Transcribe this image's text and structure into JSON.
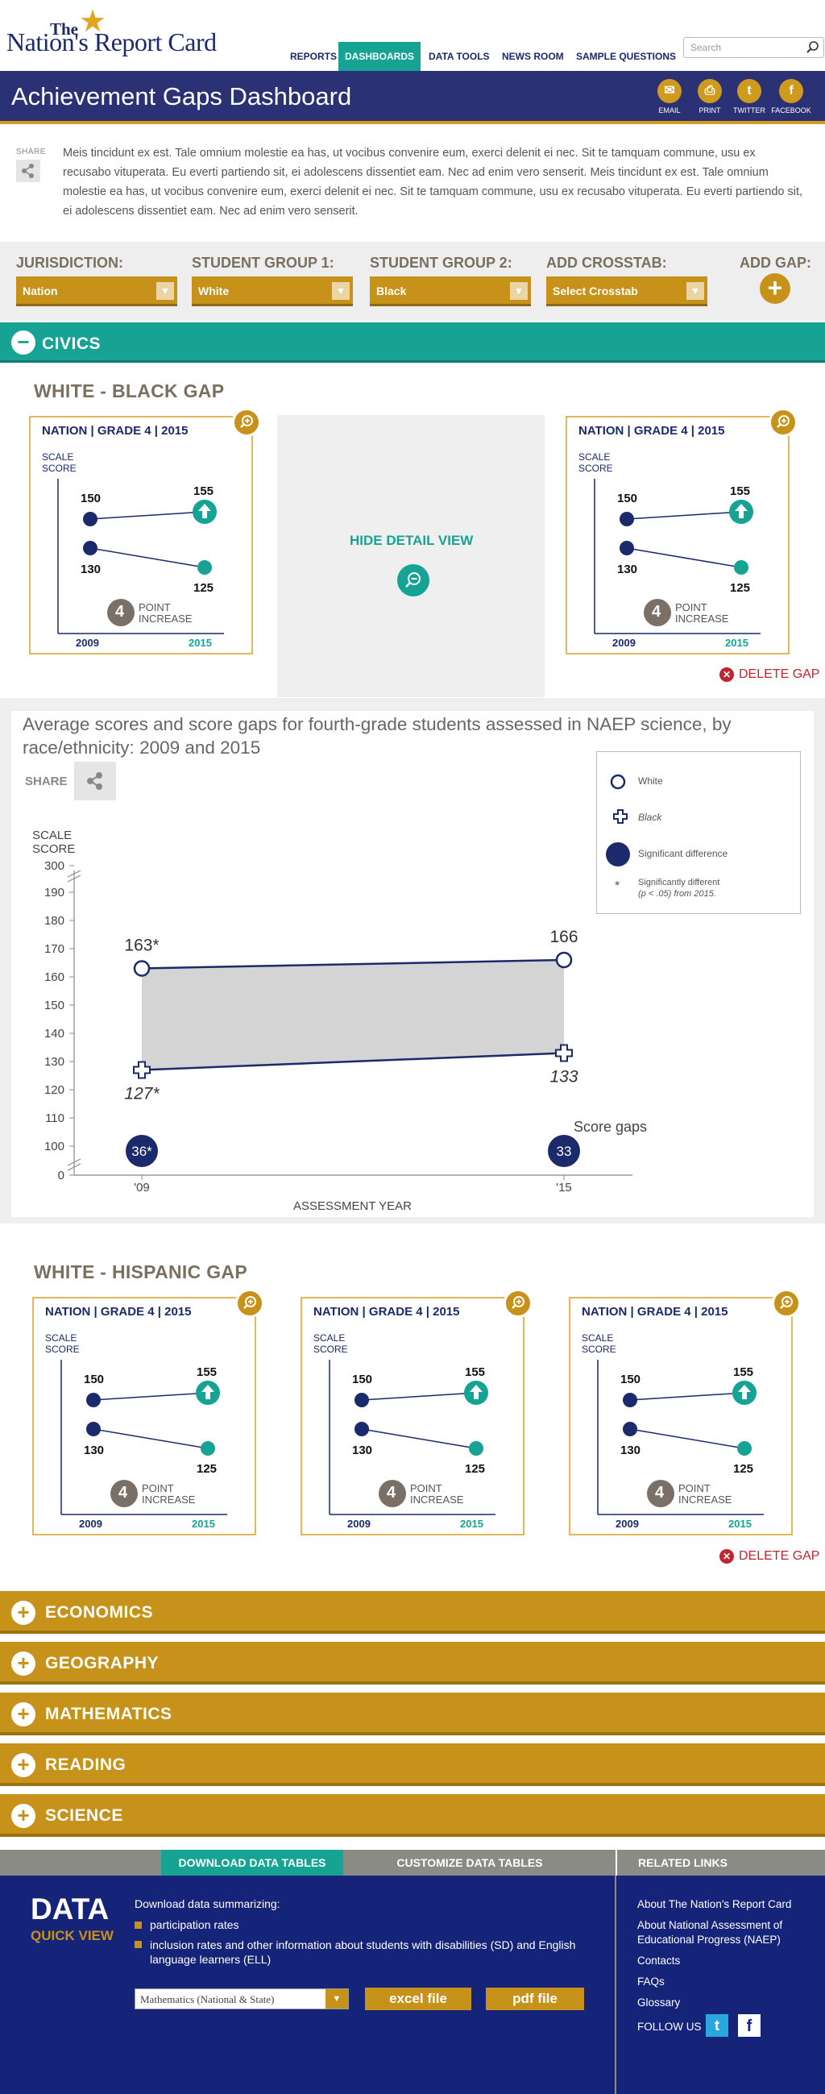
{
  "header": {
    "logo_the": "The",
    "logo_main": "Nation's Report Card",
    "nav": [
      "REPORTS",
      "DASHBOARDS",
      "DATA TOOLS",
      "NEWS ROOM",
      "SAMPLE QUESTIONS"
    ],
    "search_placeholder": "Search",
    "title": "Achievement Gaps Dashboard",
    "social": [
      {
        "label": "EMAIL",
        "glyph": "✉"
      },
      {
        "label": "PRINT",
        "glyph": "⎙"
      },
      {
        "label": "TWITTER",
        "glyph": "t"
      },
      {
        "label": "FACEBOOK",
        "glyph": "f"
      }
    ]
  },
  "intro": {
    "share_label": "SHARE",
    "text": "Meis tincidunt ex est. Tale omnium molestie ea has, ut vocibus convenire eum, exerci delenit ei nec. Sit te tamquam commune, usu ex recusabo vituperata. Eu everti partiendo sit, ei adolescens dissentiet eam. Nec ad enim vero senserit. Meis tincidunt ex est. Tale omnium molestie ea has, ut vocibus convenire eum, exerci delenit ei nec. Sit te tamquam commune, usu ex recusabo vituperata. Eu everti partiendo sit, ei adolescens dissentiet eam. Nec ad enim vero senserit."
  },
  "filters": {
    "jurisdiction_label": "JURISDICTION:",
    "jurisdiction_value": "Nation",
    "group1_label": "STUDENT GROUP 1:",
    "group1_value": "White",
    "group2_label": "STUDENT GROUP 2:",
    "group2_value": "Black",
    "crosstab_label": "ADD CROSSTAB:",
    "crosstab_value": "Select Crosstab",
    "addgap_label": "ADD GAP:"
  },
  "civics": {
    "title": "CIVICS",
    "gap1_title": "WHITE - BLACK GAP",
    "gap2_title": "WHITE - HISPANIC GAP",
    "hide_detail": "HIDE DETAIL VIEW",
    "delete_gap": "DELETE GAP"
  },
  "card": {
    "header": "NATION  |  GRADE 4  |  2015",
    "scale": "SCALE",
    "score": "SCORE",
    "v1": "150",
    "v2": "155",
    "v3": "130",
    "v4": "125",
    "gap": "4",
    "point": "POINT",
    "increase": "INCREASE",
    "year1": "2009",
    "year2": "2015"
  },
  "detail": {
    "share": "SHARE",
    "ylabel_1": "SCALE",
    "ylabel_2": "SCORE",
    "xlabel": "ASSESSMENT YEAR",
    "score_gaps": "Score gaps",
    "legend": {
      "white": "White",
      "black": "Black",
      "sig": "Significant difference",
      "sig2_star": "*",
      "sig2_a": "Significantly different",
      "sig2_b": "(p < .05) from 2015."
    }
  },
  "chart_data": {
    "type": "line",
    "title": "Average scores and score gaps for fourth-grade students assessed in NAEP science, by race/ethnicity: 2009 and 2015",
    "xlabel": "ASSESSMENT YEAR",
    "ylabel": "SCALE SCORE",
    "categories": [
      "'09",
      "'15"
    ],
    "yticks": [
      "300",
      "190",
      "180",
      "170",
      "160",
      "150",
      "140",
      "130",
      "120",
      "110",
      "100",
      "0"
    ],
    "ylim": [
      100,
      190
    ],
    "series": [
      {
        "name": "White",
        "values": [
          163,
          166
        ],
        "labels": [
          "163*",
          "166"
        ]
      },
      {
        "name": "Black",
        "values": [
          127,
          133
        ],
        "labels": [
          "127*",
          "133"
        ]
      }
    ],
    "score_gaps": [
      "36*",
      "33"
    ],
    "legend_position": "top-right",
    "colors": {
      "line": "#1b2a6b",
      "fill": "#d4d4d4"
    }
  },
  "accordion": [
    "ECONOMICS",
    "GEOGRAPHY",
    "MATHEMATICS",
    "READING",
    "SCIENCE"
  ],
  "footer": {
    "tab_download": "DOWNLOAD DATA TABLES",
    "tab_customize": "CUSTOMIZE DATA TABLES",
    "tab_related": "RELATED LINKS",
    "data": "DATA",
    "quick_view": "QUICK VIEW",
    "download_intro": "Download data summarizing:",
    "bullet1": "participation rates",
    "bullet2": "inclusion rates and other information about students with disabilities (SD) and English language learners (ELL)",
    "select_value": "Mathematics (National & State)",
    "excel": "excel file",
    "pdf": "pdf file",
    "links": [
      "About The Nation's Report Card",
      "About National Assessment of Educational Progress (NAEP)",
      "Contacts",
      "FAQs",
      "Glossary"
    ],
    "follow": "FOLLOW US"
  },
  "colors": {
    "navy": "#2a3175",
    "teal": "#16a394",
    "gold": "#c6921a",
    "red": "#c0262f"
  }
}
